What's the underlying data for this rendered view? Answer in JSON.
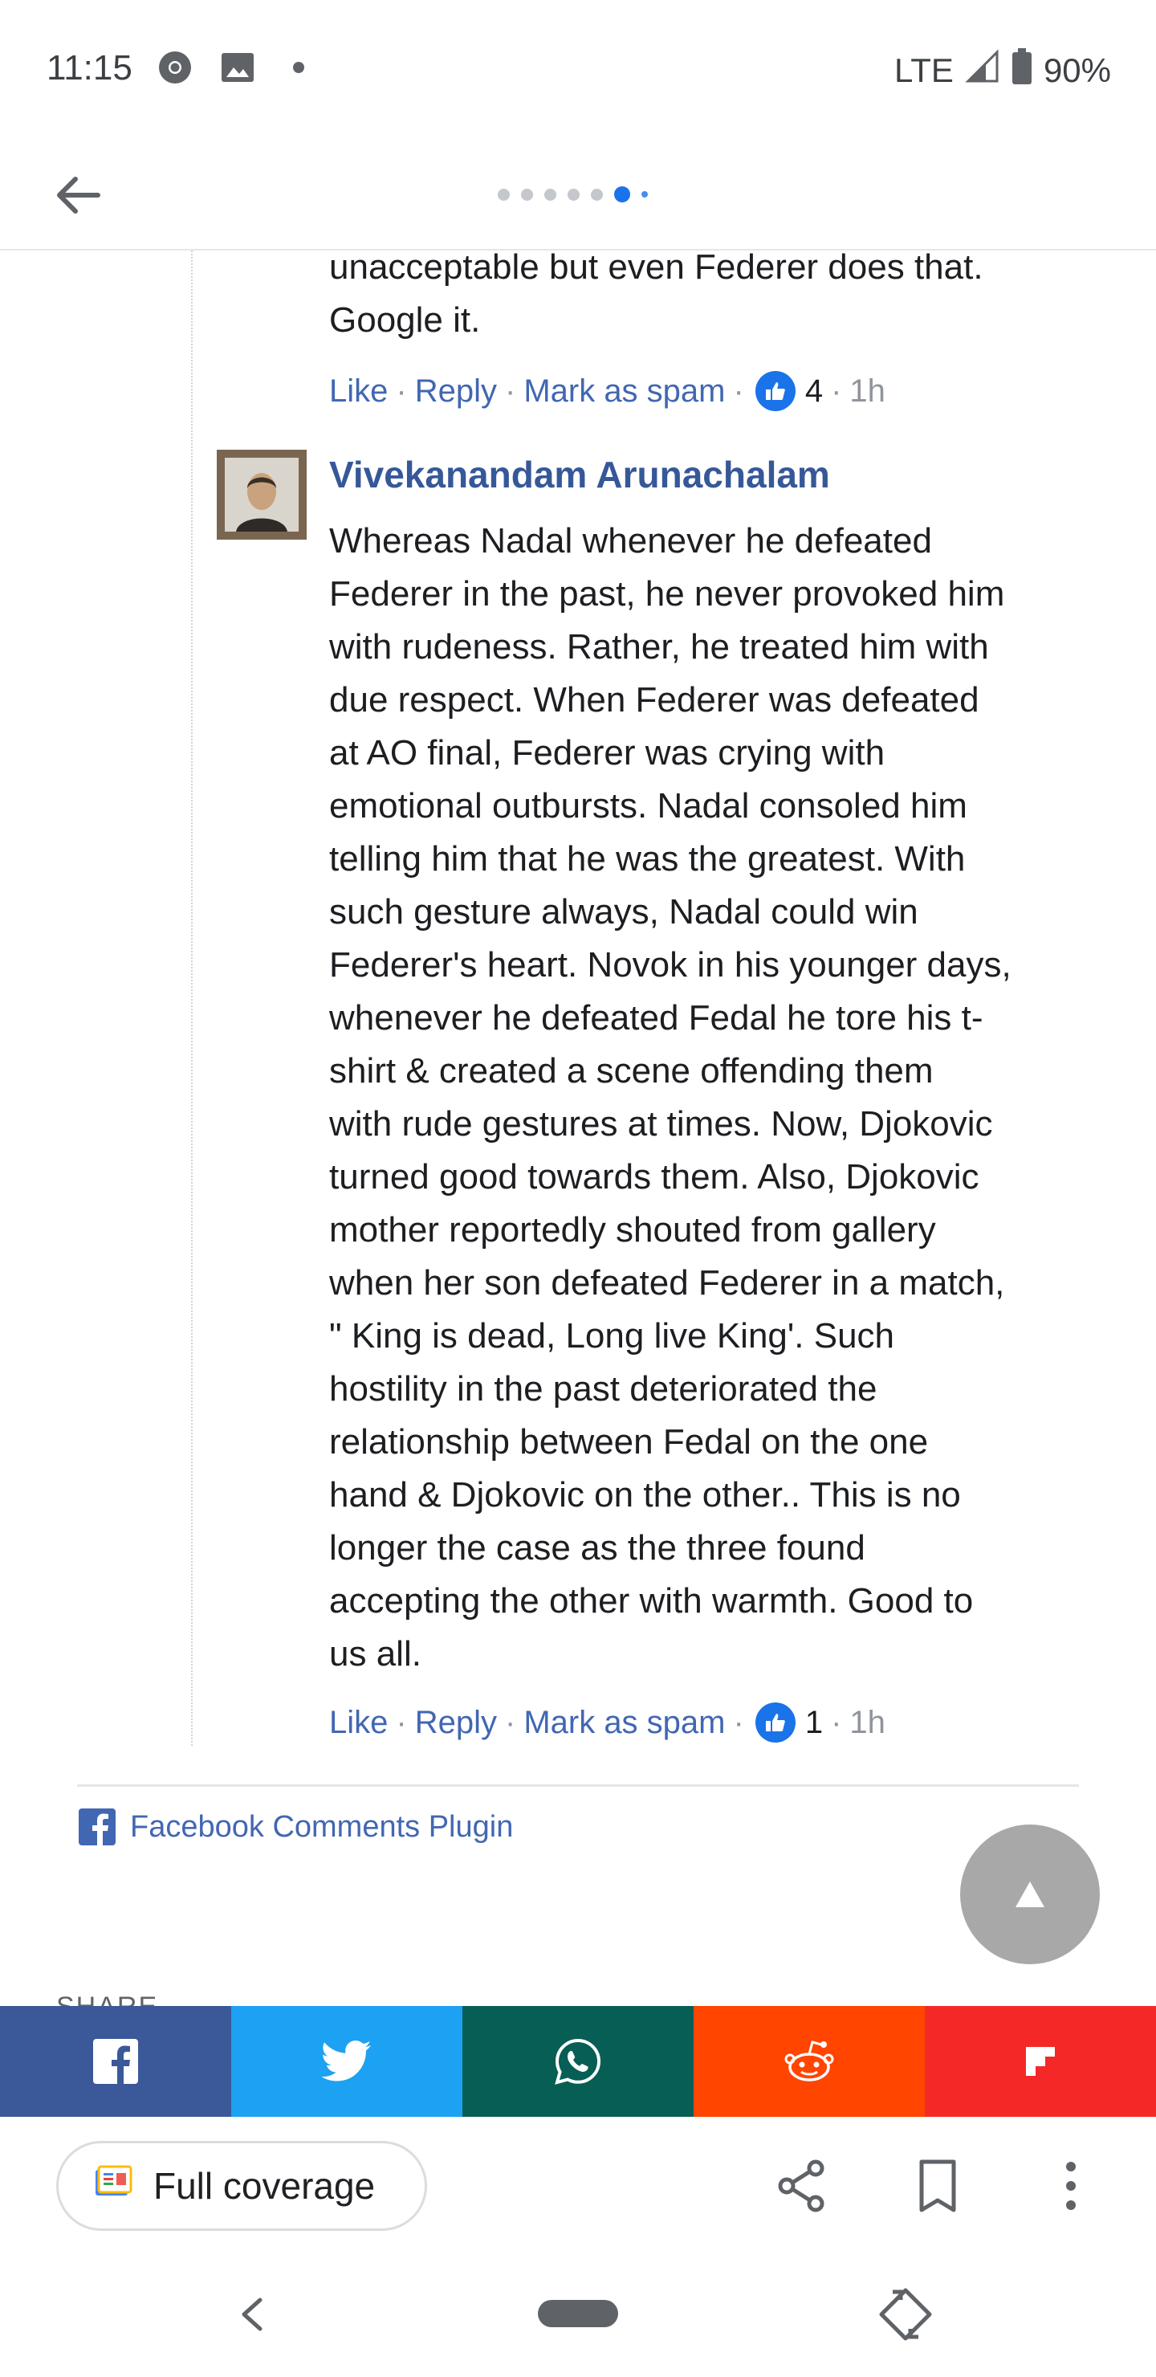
{
  "status_bar": {
    "time": "11:15",
    "network": "LTE",
    "battery": "90%",
    "icons": [
      "chrome-icon",
      "image-icon",
      "notification-dot-icon",
      "signal-icon",
      "battery-icon"
    ]
  },
  "top_bar": {
    "back_icon": "arrow-left-icon",
    "pages_total": 7,
    "active_page": 6
  },
  "comments": [
    {
      "text_lines": [
        "unacceptable but even Federer does that.",
        "Google it."
      ],
      "actions": {
        "like": "Like",
        "reply": "Reply",
        "spam": "Mark as spam",
        "like_count": "4",
        "time": "1h"
      }
    },
    {
      "author": "Vivekanandam Arunachalam",
      "text_lines": [
        "Whereas Nadal whenever he defeated",
        "Federer in the past, he never provoked him",
        "with rudeness. Rather, he treated him with",
        "due respect. When Federer was defeated",
        "at AO final, Federer was crying with",
        "emotional outbursts. Nadal consoled him",
        "telling him that he was the greatest. With",
        "such gesture always, Nadal could win",
        "Federer's heart. Novok in his younger days,",
        "whenever he defeated Fedal he tore his t-",
        "shirt & created a scene offending them",
        "with rude gestures at times. Now, Djokovic",
        "turned good towards them. Also, Djokovic",
        "mother reportedly shouted from gallery",
        "when her son defeated Federer in a match,",
        "\" King is dead, Long live King'. Such",
        "hostility in the past deteriorated the",
        "relationship between Fedal on the one",
        "hand & Djokovic on the other.. This is no",
        "longer the case as the three found",
        "accepting the other with warmth. Good to",
        "us all."
      ],
      "actions": {
        "like": "Like",
        "reply": "Reply",
        "spam": "Mark as spam",
        "like_count": "1",
        "time": "1h"
      }
    }
  ],
  "plugin_label": "Facebook Comments Plugin",
  "share_section_label": "SHARE",
  "share_buttons": [
    {
      "name": "facebook",
      "color": "#3b5998"
    },
    {
      "name": "twitter",
      "color": "#1da1f2"
    },
    {
      "name": "whatsapp",
      "color": "#075e54"
    },
    {
      "name": "reddit",
      "color": "#ff4500"
    },
    {
      "name": "flipboard",
      "color": "#f52828"
    }
  ],
  "bottom_bar": {
    "full_coverage_label": "Full coverage",
    "icons": [
      "share-icon",
      "bookmark-icon",
      "more-vert-icon"
    ]
  },
  "nav_bar": {
    "icons": [
      "nav-back-icon",
      "nav-home-pill",
      "rotate-icon"
    ]
  }
}
